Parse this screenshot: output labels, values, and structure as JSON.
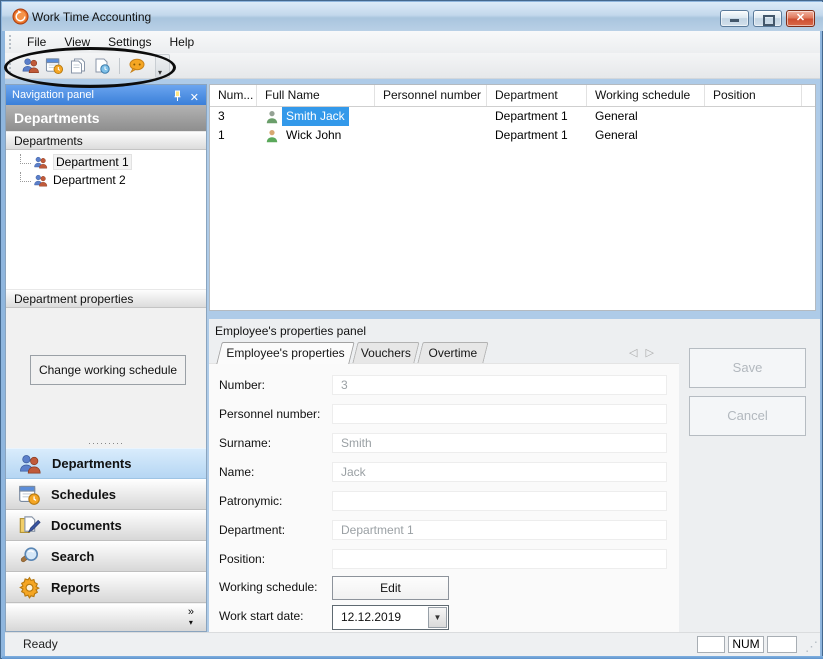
{
  "window": {
    "title": "Work Time Accounting"
  },
  "glyphs": {
    "close": "✕",
    "chevron_double_right": "»",
    "chevron_down": "▾",
    "arrow_left": "◁",
    "arrow_right": "▷",
    "combo_arrow": "▼",
    "splitter_dots": "·········",
    "resize_grip": "⋰"
  },
  "menu": {
    "items": [
      {
        "label": "File"
      },
      {
        "label": "View"
      },
      {
        "label": "Settings"
      },
      {
        "label": "Help"
      }
    ]
  },
  "toolbar": {
    "icons": [
      "departments-icon",
      "schedules-icon",
      "documents-icon",
      "document-time-icon",
      "help-bubble-icon"
    ]
  },
  "navigation_panel": {
    "title": "Navigation panel",
    "section_header": "Departments",
    "group_label": "Departments",
    "tree_items": [
      {
        "label": "Department 1"
      },
      {
        "label": "Department 2"
      }
    ],
    "properties_label": "Department properties",
    "change_schedule_button": "Change working schedule"
  },
  "sidebar": {
    "items": [
      {
        "label": "Departments",
        "selected": true
      },
      {
        "label": "Schedules",
        "selected": false
      },
      {
        "label": "Documents",
        "selected": false
      },
      {
        "label": "Search",
        "selected": false
      },
      {
        "label": "Reports",
        "selected": false
      }
    ]
  },
  "employee_table": {
    "columns": [
      "Num...",
      "Full Name",
      "Personnel number",
      "Department",
      "Working schedule",
      "Position"
    ],
    "rows": [
      {
        "num": "3",
        "full_name": "Smith Jack",
        "personnel_number": "",
        "department": "Department 1",
        "working_schedule": "General",
        "position": "",
        "selected": true
      },
      {
        "num": "1",
        "full_name": "Wick John",
        "personnel_number": "",
        "department": "Department 1",
        "working_schedule": "General",
        "position": "",
        "selected": false
      }
    ]
  },
  "properties_panel": {
    "title": "Employee's properties panel",
    "tabs": [
      {
        "label": "Employee's properties",
        "active": true
      },
      {
        "label": "Vouchers",
        "active": false
      },
      {
        "label": "Overtime",
        "active": false
      }
    ],
    "fields": [
      {
        "label": "Number:",
        "value": "3"
      },
      {
        "label": "Personnel number:",
        "value": ""
      },
      {
        "label": "Surname:",
        "value": "Smith"
      },
      {
        "label": "Name:",
        "value": "Jack"
      },
      {
        "label": "Patronymic:",
        "value": ""
      },
      {
        "label": "Department:",
        "value": "Department 1"
      },
      {
        "label": "Position:",
        "value": ""
      }
    ],
    "working_schedule_label": "Working schedule:",
    "edit_button": "Edit",
    "work_start_date_label": "Work start date:",
    "work_start_date_value": "12.12.2019",
    "save_button": "Save",
    "cancel_button": "Cancel"
  },
  "status_bar": {
    "ready": "Ready",
    "num": "NUM"
  },
  "colors": {
    "selection": "#3399ea",
    "nav_header_blue": "#3f8be4",
    "annotation": "#0c0c0c"
  }
}
